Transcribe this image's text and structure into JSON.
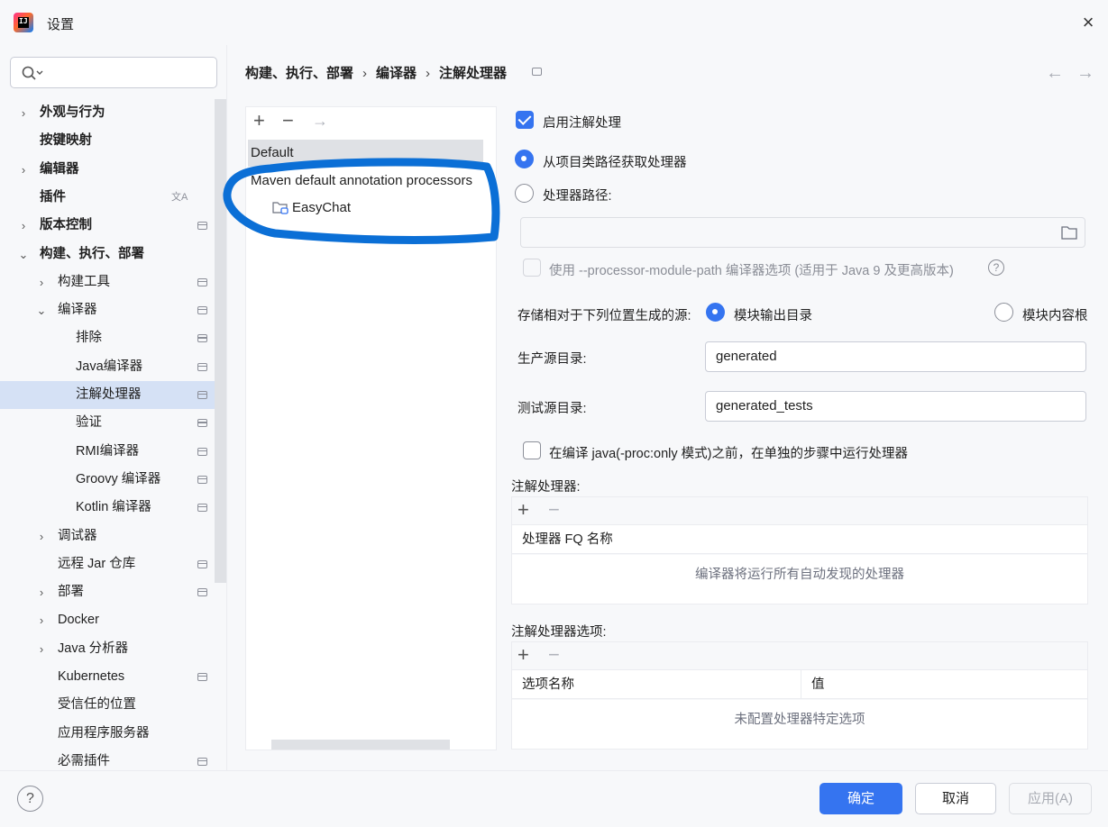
{
  "window": {
    "title": "设置",
    "close_icon": "×"
  },
  "search": {
    "placeholder": ""
  },
  "sidebar": {
    "items": [
      {
        "label": "外观与行为",
        "bold": true,
        "chevron": "›"
      },
      {
        "label": "按键映射",
        "bold": true
      },
      {
        "label": "编辑器",
        "bold": true,
        "chevron": "›"
      },
      {
        "label": "插件",
        "bold": true,
        "badge": "translate-icon"
      },
      {
        "label": "版本控制",
        "bold": true,
        "chevron": "›",
        "badge": "project-icon"
      },
      {
        "label": "构建、执行、部署",
        "bold": true,
        "chevron": "⌄"
      },
      {
        "label": "构建工具",
        "chevron": "›",
        "badge": "project-icon"
      },
      {
        "label": "编译器",
        "chevron": "⌄",
        "badge": "project-icon"
      },
      {
        "label": "排除",
        "badge": "project-icon"
      },
      {
        "label": "Java编译器",
        "badge": "project-icon"
      },
      {
        "label": "注解处理器",
        "badge": "project-icon",
        "selected": true
      },
      {
        "label": "验证",
        "badge": "project-icon"
      },
      {
        "label": "RMI编译器",
        "badge": "project-icon"
      },
      {
        "label": "Groovy 编译器",
        "badge": "project-icon"
      },
      {
        "label": "Kotlin 编译器",
        "badge": "project-icon"
      },
      {
        "label": "调试器",
        "chevron": "›"
      },
      {
        "label": "远程 Jar 仓库",
        "badge": "project-icon"
      },
      {
        "label": "部署",
        "chevron": "›",
        "badge": "project-icon"
      },
      {
        "label": "Docker",
        "chevron": "›"
      },
      {
        "label": "Java 分析器",
        "chevron": "›"
      },
      {
        "label": "Kubernetes",
        "badge": "project-icon"
      },
      {
        "label": "受信任的位置"
      },
      {
        "label": "应用程序服务器"
      },
      {
        "label": "必需插件",
        "badge": "project-icon"
      }
    ]
  },
  "breadcrumb": {
    "items": [
      "构建、执行、部署",
      "编译器",
      "注解处理器"
    ],
    "separator": "›",
    "back": "←",
    "forward": "→"
  },
  "profiles": {
    "toolbar": {
      "add": "+",
      "remove": "−",
      "move": "→"
    },
    "default": "Default",
    "maven": "Maven default annotation processors",
    "module": "EasyChat"
  },
  "settings": {
    "enable_processing": "启用注解处理",
    "obtain_from_classpath": "从项目类路径获取处理器",
    "processor_path": "处理器路径:",
    "processor_path_value": "",
    "use_module_path": "使用 --processor-module-path 编译器选项 (适用于 Java 9 及更高版本)",
    "help_glyph": "?",
    "store_label": "存储相对于下列位置生成的源:",
    "module_output": "模块输出目录",
    "module_content_root": "模块内容根",
    "prod_dir_label": "生产源目录:",
    "prod_dir_value": "generated",
    "test_dir_label": "测试源目录:",
    "test_dir_value": "generated_tests",
    "separate_step": "在编译 java(-proc:only 模式)之前，在单独的步骤中运行处理器"
  },
  "processors_table": {
    "title": "注解处理器:",
    "add": "+",
    "remove": "−",
    "column": "处理器 FQ 名称",
    "empty": "编译器将运行所有自动发现的处理器"
  },
  "options_table": {
    "title": "注解处理器选项:",
    "add": "+",
    "remove": "−",
    "col_name": "选项名称",
    "col_value": "值",
    "empty": "未配置处理器特定选项"
  },
  "footer": {
    "help": "?",
    "ok": "确定",
    "cancel": "取消",
    "apply": "应用(A)"
  },
  "colors": {
    "accent": "#3574f0",
    "selection": "#d5e1f5",
    "annotation_circle": "#0b6fd6"
  }
}
